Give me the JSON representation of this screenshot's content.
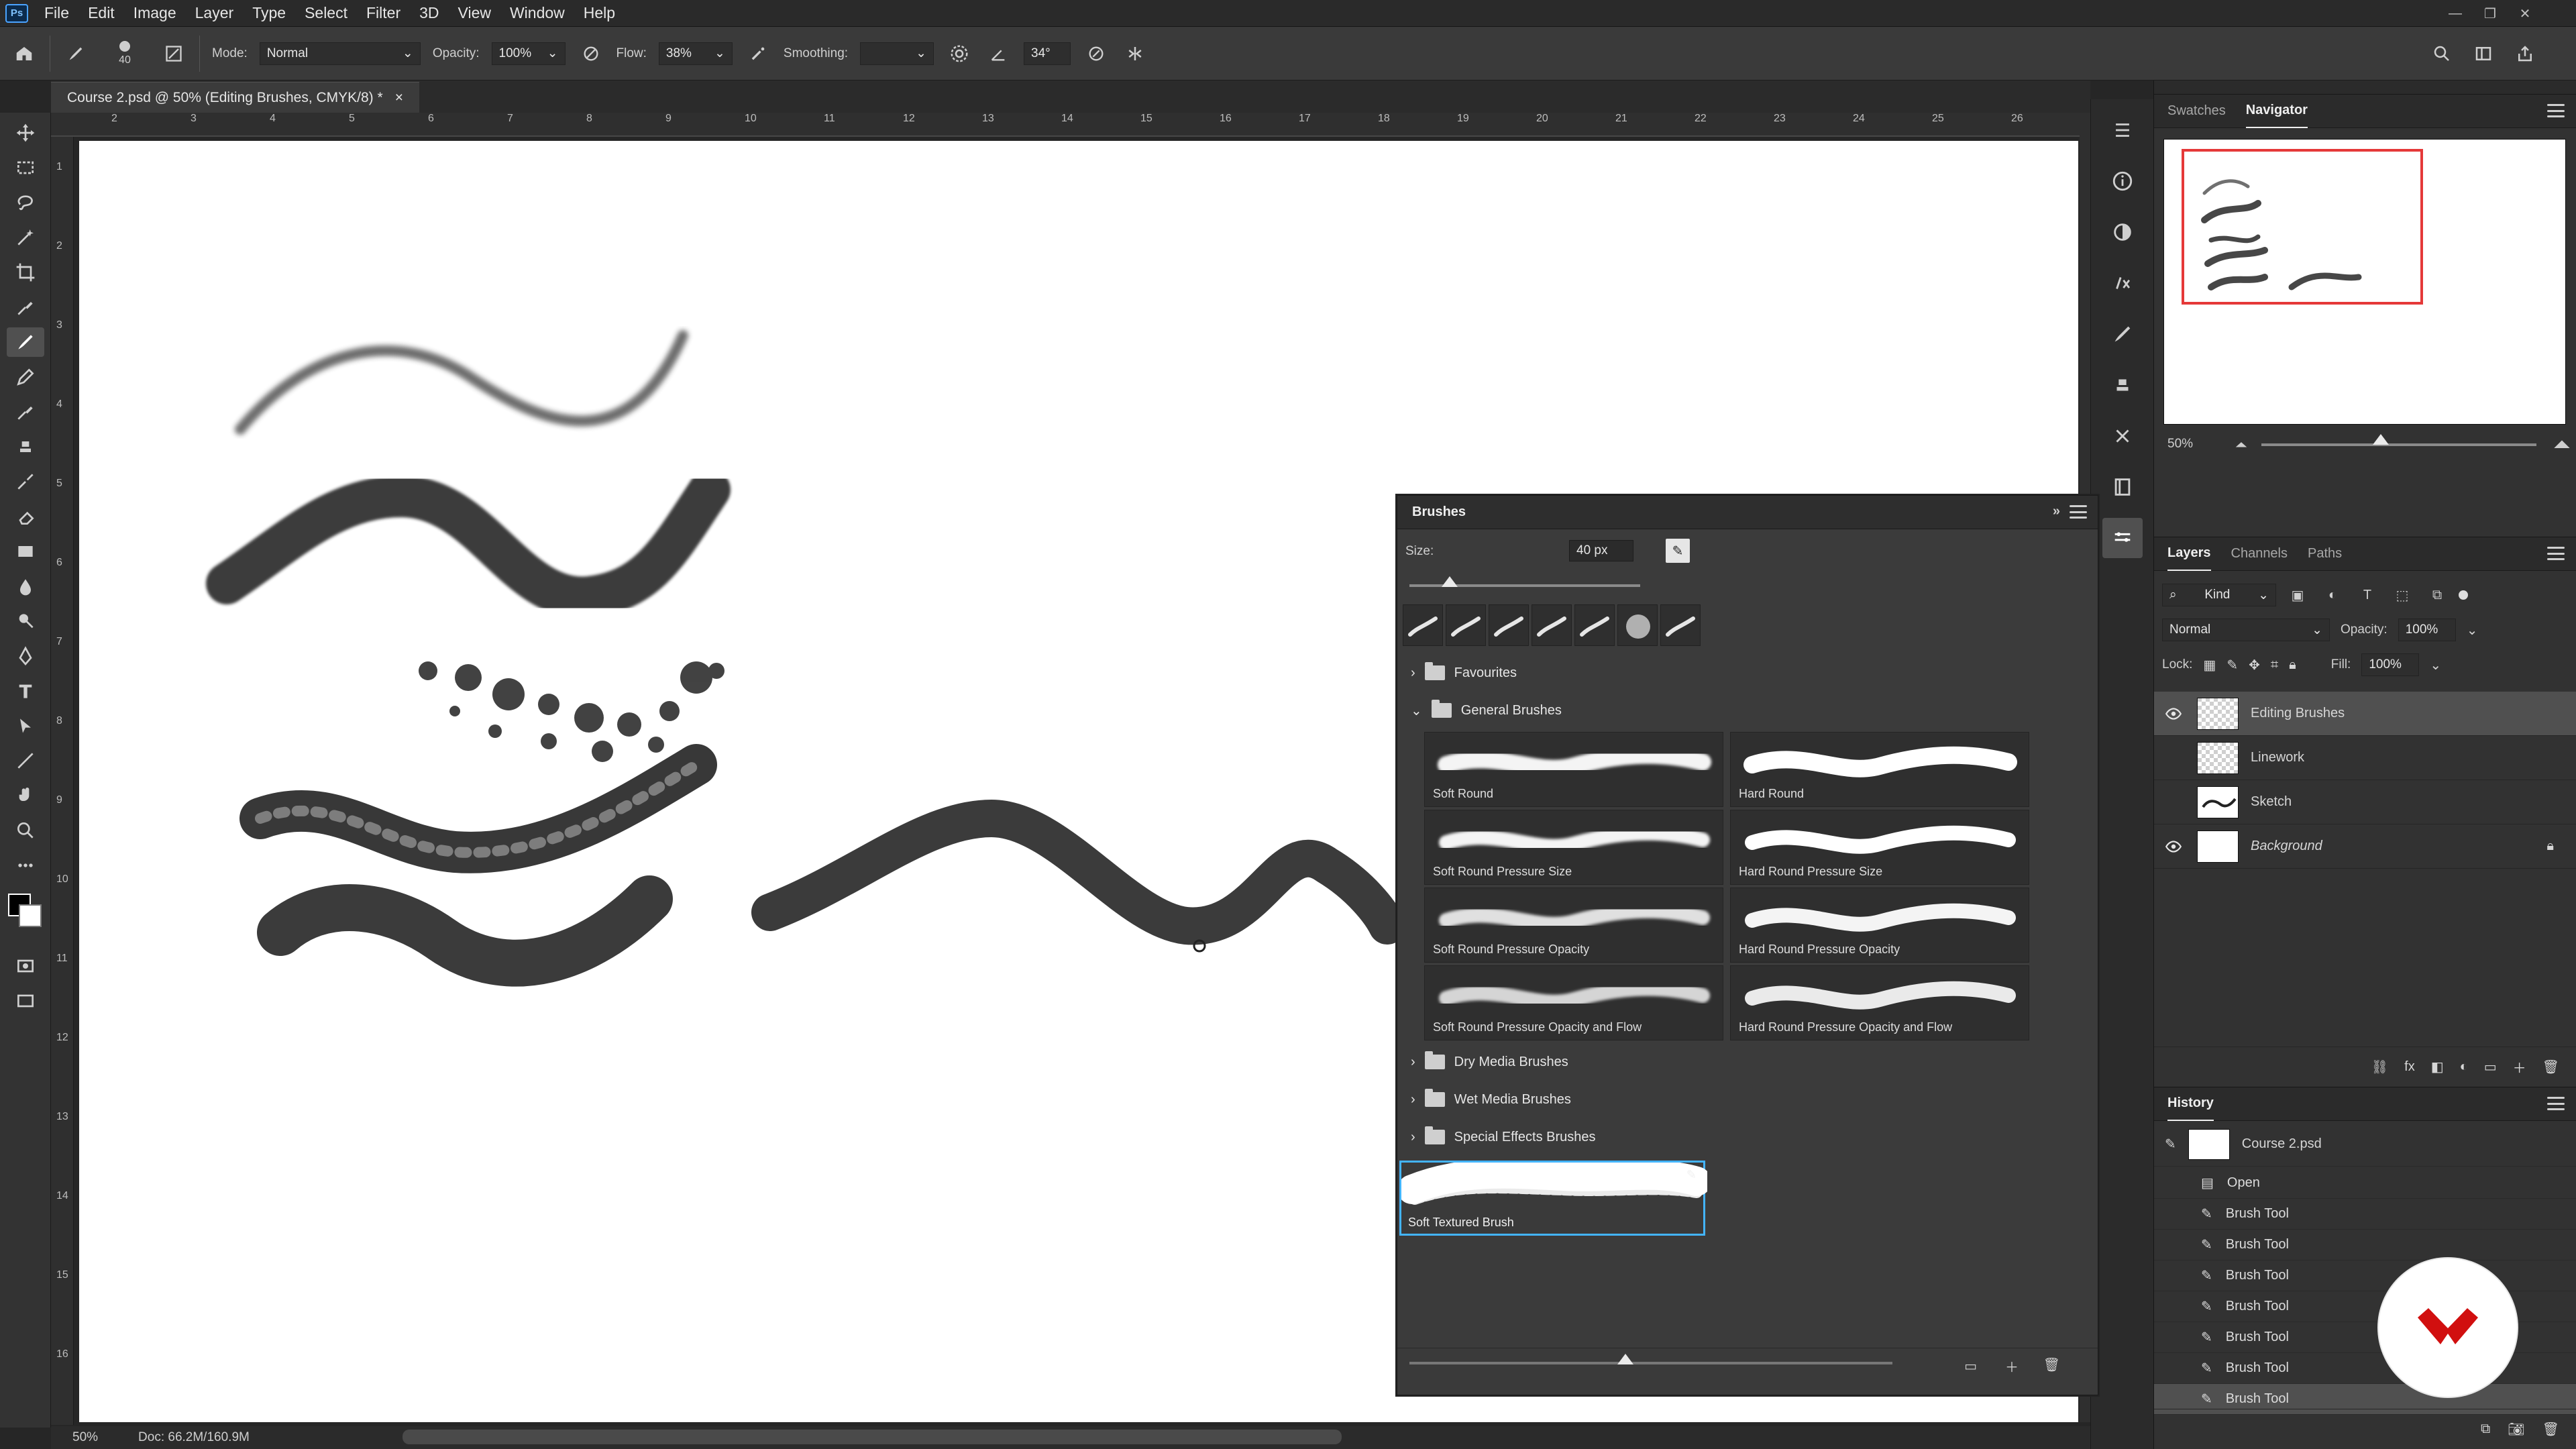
{
  "menubar": {
    "logo": "Ps",
    "items": [
      "File",
      "Edit",
      "Image",
      "Layer",
      "Type",
      "Select",
      "Filter",
      "3D",
      "View",
      "Window",
      "Help"
    ]
  },
  "options": {
    "size_value": "40",
    "mode_label": "Mode:",
    "mode_value": "Normal",
    "opacity_label": "Opacity:",
    "opacity_value": "100%",
    "flow_label": "Flow:",
    "flow_value": "38%",
    "smoothing_label": "Smoothing:",
    "smoothing_value": "",
    "angle_value": "34°"
  },
  "document": {
    "tab_title": "Course 2.psd @ 50% (Editing Brushes, CMYK/8) *",
    "close_icon": "×",
    "zoom": "50%",
    "doc_size": "Doc: 66.2M/160.9M"
  },
  "ruler": {
    "top_numbers": [
      "2",
      "3",
      "4",
      "5",
      "6",
      "7",
      "8",
      "9",
      "10",
      "11",
      "12",
      "13",
      "14",
      "15",
      "16",
      "17",
      "18",
      "19",
      "20",
      "21",
      "22",
      "23",
      "24",
      "25",
      "26"
    ],
    "left_numbers": [
      "1",
      "2",
      "3",
      "4",
      "5",
      "6",
      "7",
      "8",
      "9",
      "10",
      "11",
      "12",
      "13",
      "14",
      "15",
      "16"
    ]
  },
  "navigator": {
    "tabs": [
      "Swatches",
      "Navigator"
    ],
    "active_tab": "Navigator",
    "zoom": "50%"
  },
  "layers_panel": {
    "tabs": [
      "Layers",
      "Channels",
      "Paths"
    ],
    "active_tab": "Layers",
    "filter_kind": "Kind",
    "blend_mode": "Normal",
    "opacity_label": "Opacity:",
    "opacity_value": "100%",
    "lock_label": "Lock:",
    "fill_label": "Fill:",
    "fill_value": "100%",
    "layers": [
      {
        "name": "Editing Brushes",
        "visible": true,
        "selected": true,
        "type": "transparent"
      },
      {
        "name": "Linework",
        "visible": false,
        "selected": false,
        "type": "transparent"
      },
      {
        "name": "Sketch",
        "visible": false,
        "selected": false,
        "type": "sketch"
      },
      {
        "name": "Background",
        "visible": true,
        "selected": false,
        "type": "white",
        "locked": true
      }
    ]
  },
  "history_panel": {
    "title": "History",
    "snapshot": "Course 2.psd",
    "items": [
      "Open",
      "Brush Tool",
      "Brush Tool",
      "Brush Tool",
      "Brush Tool",
      "Brush Tool",
      "Brush Tool",
      "Brush Tool"
    ],
    "selected_index": 7
  },
  "brushes_panel": {
    "title": "Brushes",
    "size_label": "Size:",
    "size_value": "40 px",
    "folders": [
      {
        "name": "Favourites",
        "expanded": false
      },
      {
        "name": "General Brushes",
        "expanded": true
      },
      {
        "name": "Dry Media Brushes",
        "expanded": false
      },
      {
        "name": "Wet Media Brushes",
        "expanded": false
      },
      {
        "name": "Special Effects Brushes",
        "expanded": false
      }
    ],
    "general_brushes": [
      {
        "name": "Soft Round",
        "style": "soft"
      },
      {
        "name": "Hard Round",
        "style": "hard"
      },
      {
        "name": "Soft Round Pressure Size",
        "style": "soft"
      },
      {
        "name": "Hard Round Pressure Size",
        "style": "hard"
      },
      {
        "name": "Soft Round Pressure Opacity",
        "style": "soft"
      },
      {
        "name": "Hard Round Pressure Opacity",
        "style": "hard"
      },
      {
        "name": "Soft Round Pressure Opacity and Flow",
        "style": "soft"
      },
      {
        "name": "Hard Round Pressure Opacity and Flow",
        "style": "hard"
      }
    ],
    "selected_brush": "Soft Textured Brush"
  },
  "colors": {
    "accent_select": "#43b4ff",
    "navigator_box": "#e53939",
    "logo_red": "#d10f0f"
  }
}
